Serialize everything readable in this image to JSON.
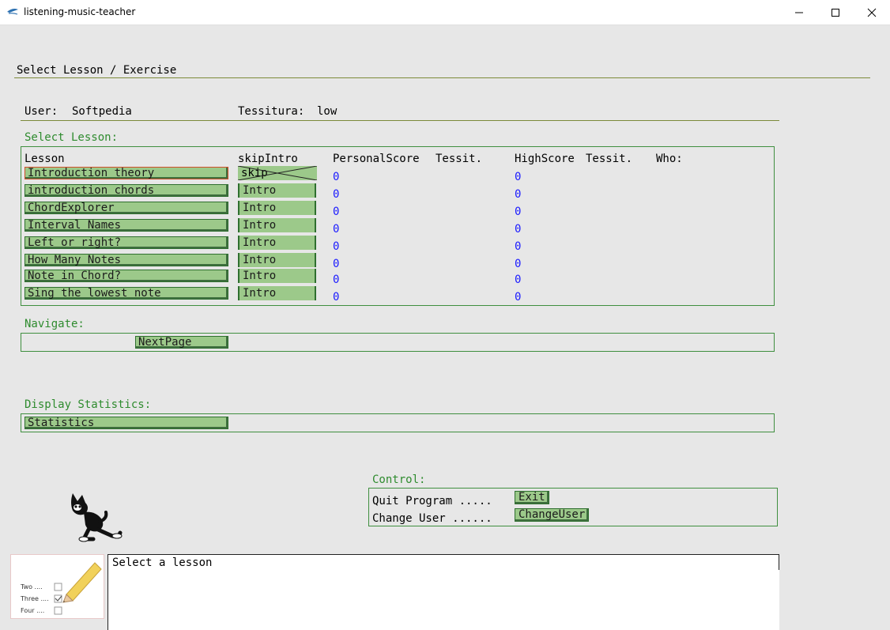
{
  "window": {
    "title": "listening-music-teacher"
  },
  "header": {
    "heading": "Select Lesson / Exercise"
  },
  "user": {
    "user_label": "User:",
    "user_name": "Softpedia",
    "tessitura_label": "Tessitura:",
    "tessitura_value": "low"
  },
  "lessons": {
    "section_label": "Select Lesson:",
    "columns": {
      "lesson": "Lesson",
      "skip_intro": "skipIntro",
      "personal_score": "PersonalScore",
      "tessit1": "Tessit.",
      "high_score": "HighScore",
      "tessit2": "Tessit.",
      "who": "Who:"
    },
    "rows": [
      {
        "name": "Introduction theory",
        "intro": "skip",
        "personal": "0",
        "high": "0"
      },
      {
        "name": "introduction chords",
        "intro": "Intro",
        "personal": "0",
        "high": "0"
      },
      {
        "name": "ChordExplorer",
        "intro": "Intro",
        "personal": "0",
        "high": "0"
      },
      {
        "name": "Interval Names",
        "intro": "Intro",
        "personal": "0",
        "high": "0"
      },
      {
        "name": "Left or right?",
        "intro": "Intro",
        "personal": "0",
        "high": "0"
      },
      {
        "name": "How Many Notes",
        "intro": "Intro",
        "personal": "0",
        "high": "0"
      },
      {
        "name": "Note in Chord?",
        "intro": "Intro",
        "personal": "0",
        "high": "0"
      },
      {
        "name": "Sing the lowest note",
        "intro": "Intro",
        "personal": "0",
        "high": "0"
      }
    ]
  },
  "navigate": {
    "section_label": "Navigate:",
    "next_page": "NextPage"
  },
  "statistics": {
    "section_label": "Display Statistics:",
    "button": "Statistics"
  },
  "control": {
    "section_label": "Control:",
    "quit_label": "Quit Program .....",
    "quit_button": "Exit",
    "change_label": "Change User ......",
    "change_button": "ChangeUser"
  },
  "status": {
    "message": "Select a lesson"
  },
  "checklist": {
    "items": [
      {
        "label": "Two ....",
        "checked": false
      },
      {
        "label": "Three ....",
        "checked": true
      },
      {
        "label": "Four ....",
        "checked": false
      }
    ]
  },
  "colors": {
    "accent_green": "#2e8b2e",
    "button_green": "#9cc98a",
    "score_blue": "#1a1aff",
    "selection_red": "#d0502a"
  }
}
